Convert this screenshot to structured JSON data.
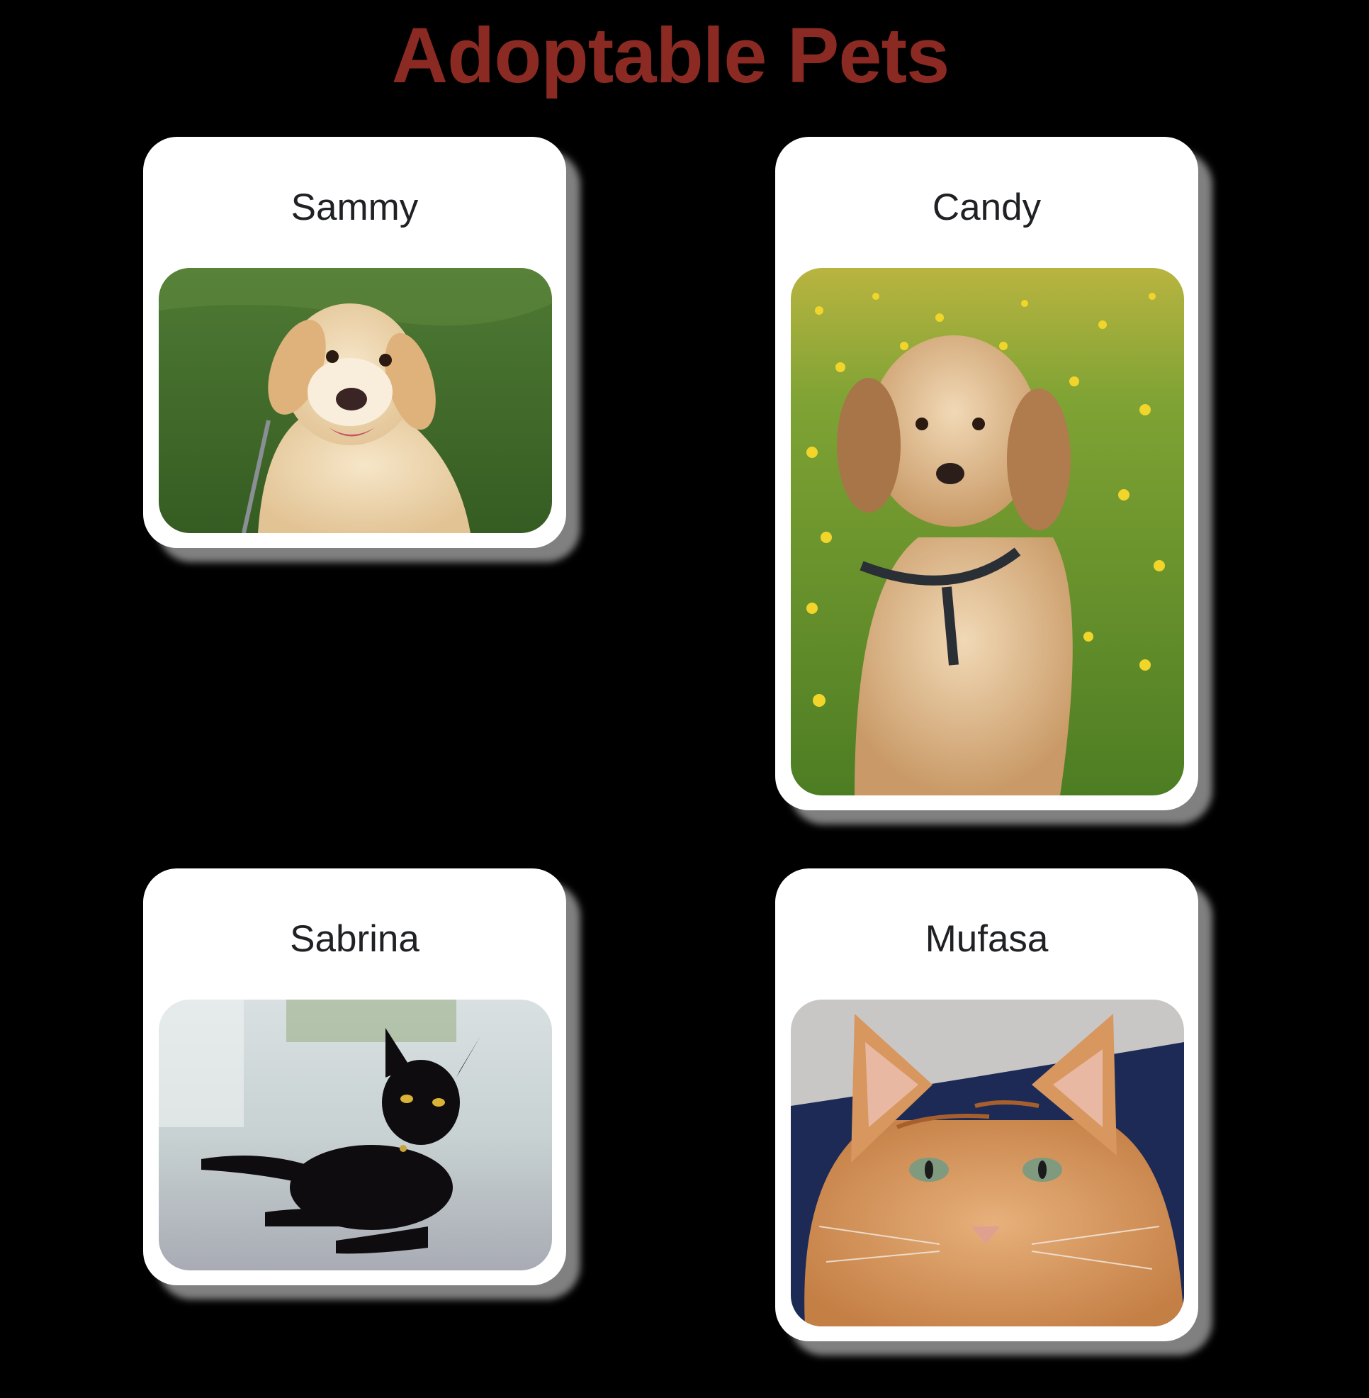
{
  "page": {
    "title": "Adoptable Pets",
    "background_color": "#000000",
    "title_color": "#8b2a22"
  },
  "pets": [
    {
      "name": "Sammy",
      "photo_icon": "golden-retriever-photo"
    },
    {
      "name": "Candy",
      "photo_icon": "cockapoo-photo"
    },
    {
      "name": "Sabrina",
      "photo_icon": "black-cat-photo"
    },
    {
      "name": "Mufasa",
      "photo_icon": "orange-tabby-cat-photo"
    }
  ]
}
